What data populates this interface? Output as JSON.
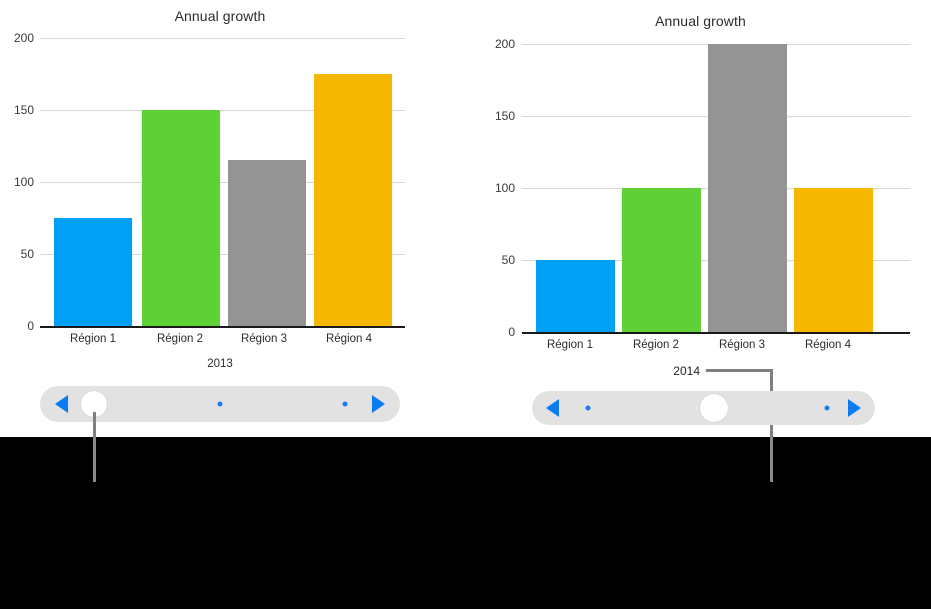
{
  "chart_data": [
    {
      "id": "left",
      "type": "bar",
      "title": "Annual growth",
      "xlabel": "",
      "ylabel": "",
      "series_label": "2013",
      "categories": [
        "Région 1",
        "Région 2",
        "Région 3",
        "Région 4"
      ],
      "values": [
        75,
        150,
        115,
        175
      ],
      "colors": [
        "#00a0f5",
        "#5fd137",
        "#949494",
        "#f5b700"
      ],
      "yticks": [
        200,
        150,
        100,
        50,
        0
      ],
      "ylim": [
        0,
        200
      ],
      "grid": true,
      "legend": "none"
    },
    {
      "id": "right",
      "type": "bar",
      "title": "Annual growth",
      "xlabel": "",
      "ylabel": "",
      "series_label": "2014",
      "categories": [
        "Région 1",
        "Région 2",
        "Région 3",
        "Région 4"
      ],
      "values": [
        50,
        100,
        200,
        100
      ],
      "colors": [
        "#00a0f5",
        "#5fd137",
        "#949494",
        "#f5b700"
      ],
      "yticks": [
        200,
        150,
        100,
        50,
        0
      ],
      "ylim": [
        0,
        200
      ],
      "grid": true,
      "legend": "none"
    }
  ],
  "left_panel": {
    "title": "Annual growth",
    "series_label": "2013",
    "yticks": [
      "200",
      "150",
      "100",
      "50",
      "0"
    ],
    "categories": [
      "Région 1",
      "Région 2",
      "Région 3",
      "Région 4"
    ],
    "slider": {
      "prev_icon": "triangle-left-icon",
      "next_icon": "triangle-right-icon",
      "knob_icon": "slider-knob",
      "dots": 2,
      "position": "start"
    }
  },
  "right_panel": {
    "title": "Annual growth",
    "series_label": "2014",
    "yticks": [
      "200",
      "150",
      "100",
      "50",
      "0"
    ],
    "categories": [
      "Région 1",
      "Région 2",
      "Région 3",
      "Région 4"
    ],
    "slider": {
      "prev_icon": "triangle-left-icon",
      "next_icon": "triangle-right-icon",
      "knob_icon": "slider-knob",
      "dots": 2,
      "position": "middle"
    }
  },
  "colors": {
    "bar_blue": "#00a0f5",
    "bar_green": "#5fd137",
    "bar_gray": "#949494",
    "bar_orange": "#f5b700",
    "accent_blue": "#0a7cf0",
    "slider_track": "#e2e2e2",
    "callout_gray": "#808080",
    "band_black": "#000000"
  }
}
